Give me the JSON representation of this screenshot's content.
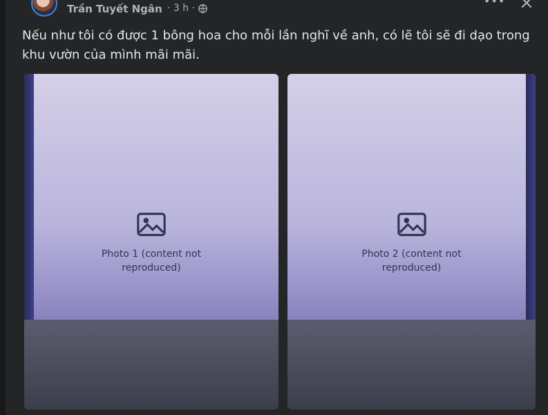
{
  "post": {
    "author": "Trần Tuyết Ngân",
    "time": "· 3 h ·",
    "privacy_icon": "globe-icon",
    "more_icon": "more-options-icon",
    "close_icon": "close-icon",
    "text": "Nếu như tôi có được 1 bông hoa cho mỗi lần nghĩ về anh, có lẽ tôi sẽ đi dạo trong khu vườn của mình mãi mãi."
  },
  "photos": [
    {
      "placeholder": "Photo 1 (content not reproduced)"
    },
    {
      "placeholder": "Photo 2 (content not reproduced)"
    }
  ],
  "colors": {
    "background": "#18191a",
    "card": "#242526",
    "text_primary": "#e4e6eb",
    "text_secondary": "#b0b3b8",
    "avatar_ring": "#2d88ff"
  }
}
